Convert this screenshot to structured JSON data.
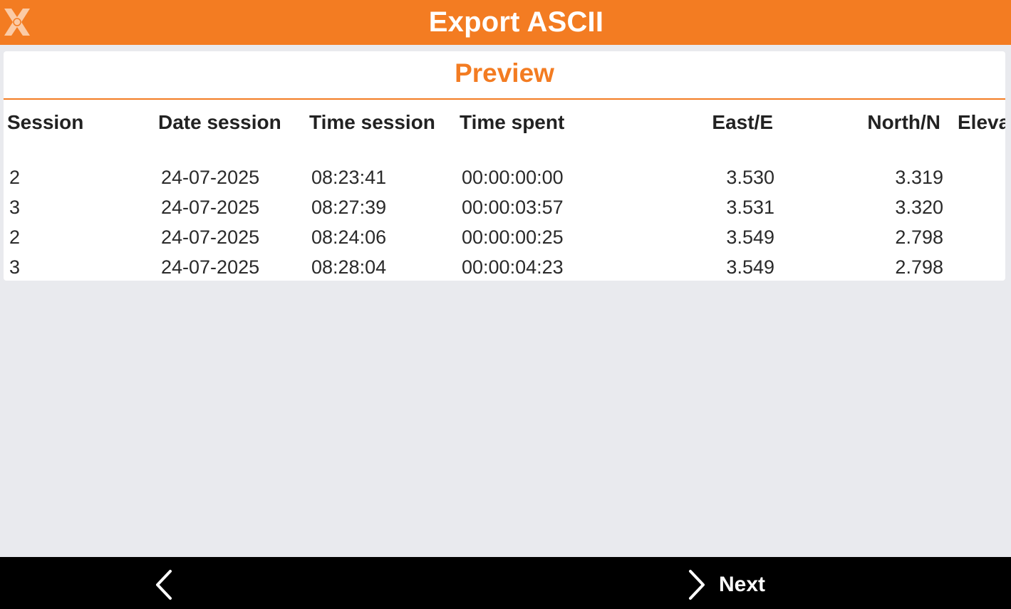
{
  "header": {
    "title": "Export ASCII",
    "logo_icon": "app-logo-icon",
    "accent_color": "#f37c22"
  },
  "preview": {
    "title": "Preview",
    "columns": [
      "Session",
      "Date session",
      "Time session",
      "Time spent",
      "East/E",
      "North/N",
      "Eleva"
    ],
    "rows": [
      [
        "2",
        "24-07-2025",
        "08:23:41",
        "00:00:00:00",
        "3.530",
        "3.319"
      ],
      [
        "3",
        "24-07-2025",
        "08:27:39",
        "00:00:03:57",
        "3.531",
        "3.320"
      ],
      [
        "2",
        "24-07-2025",
        "08:24:06",
        "00:00:00:25",
        "3.549",
        "2.798"
      ],
      [
        "3",
        "24-07-2025",
        "08:28:04",
        "00:00:04:23",
        "3.549",
        "2.798"
      ]
    ]
  },
  "footer": {
    "back_icon": "chevron-left-icon",
    "next_icon": "chevron-right-icon",
    "next_label": "Next"
  }
}
